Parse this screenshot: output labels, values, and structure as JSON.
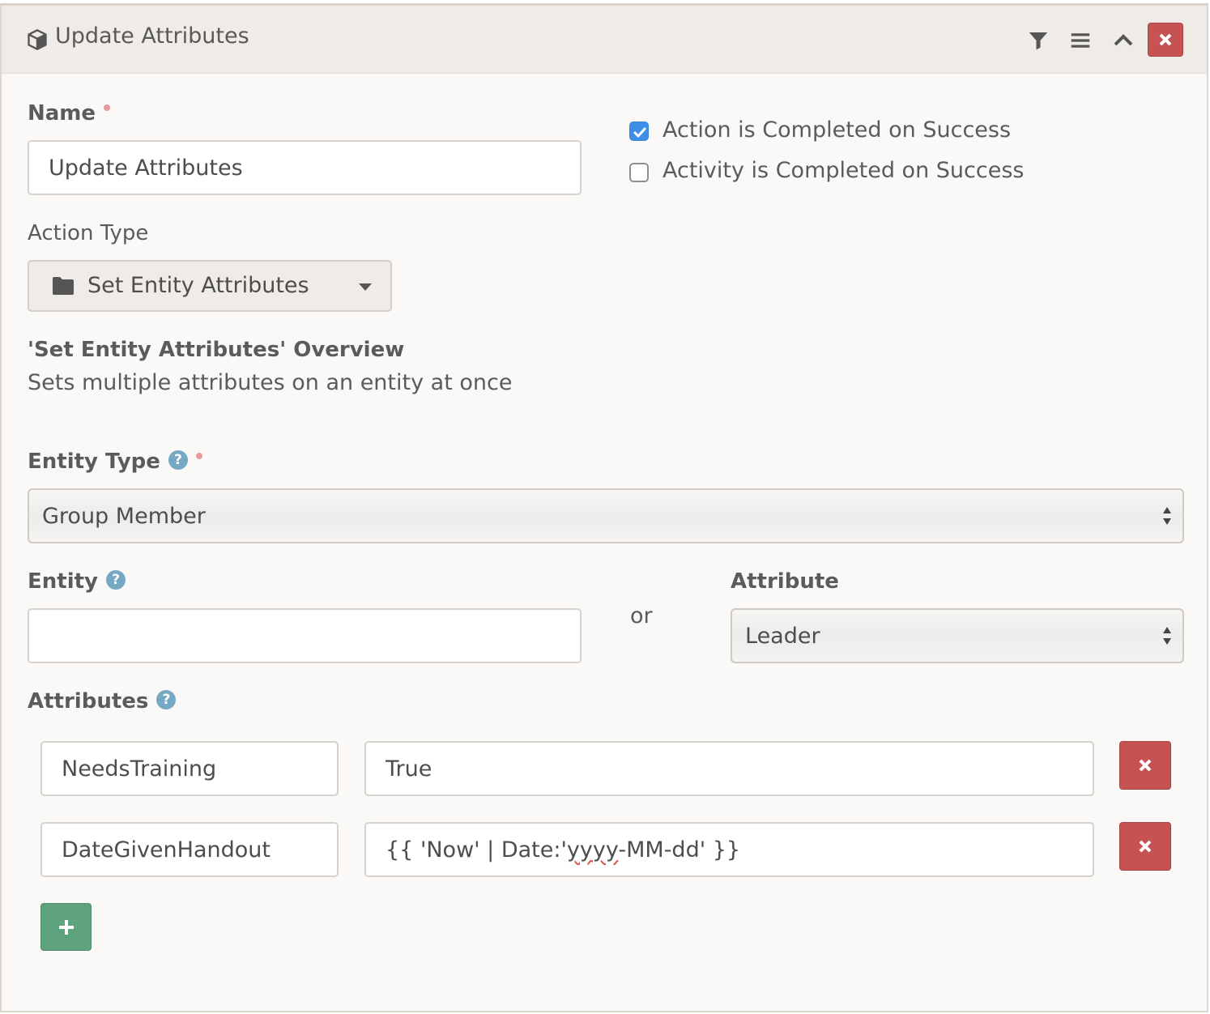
{
  "header": {
    "title": "Update Attributes",
    "icons": [
      "cube-icon",
      "filter-icon",
      "menu-icon",
      "chevron-up-icon",
      "close-icon"
    ]
  },
  "name_field": {
    "label": "Name",
    "value": "Update Attributes"
  },
  "checkboxes": [
    {
      "label": "Action is Completed on Success",
      "checked": true
    },
    {
      "label": "Activity is Completed on Success",
      "checked": false
    }
  ],
  "action_type": {
    "label": "Action Type",
    "selected": "Set Entity Attributes",
    "icon": "folder-icon"
  },
  "overview": {
    "title": "'Set Entity Attributes' Overview",
    "description": "Sets multiple attributes on an entity at once"
  },
  "entity_type": {
    "label": "Entity Type",
    "selected": "Group Member"
  },
  "entity": {
    "label": "Entity",
    "value": ""
  },
  "or_text": "or",
  "attribute": {
    "label": "Attribute",
    "selected": "Leader"
  },
  "attributes": {
    "label": "Attributes",
    "rows": [
      {
        "key": "NeedsTraining",
        "value_before": "True",
        "value_squiggle": "",
        "value_after": ""
      },
      {
        "key": "DateGivenHandout",
        "value_before": "{{ 'Now' | Date:'",
        "value_squiggle": "yyyy",
        "value_after": "-MM-dd' }}"
      }
    ]
  },
  "colors": {
    "danger": "#c65353",
    "success": "#5ea37e",
    "checkbox": "#3d8ee6",
    "help": "#76a8c3"
  }
}
